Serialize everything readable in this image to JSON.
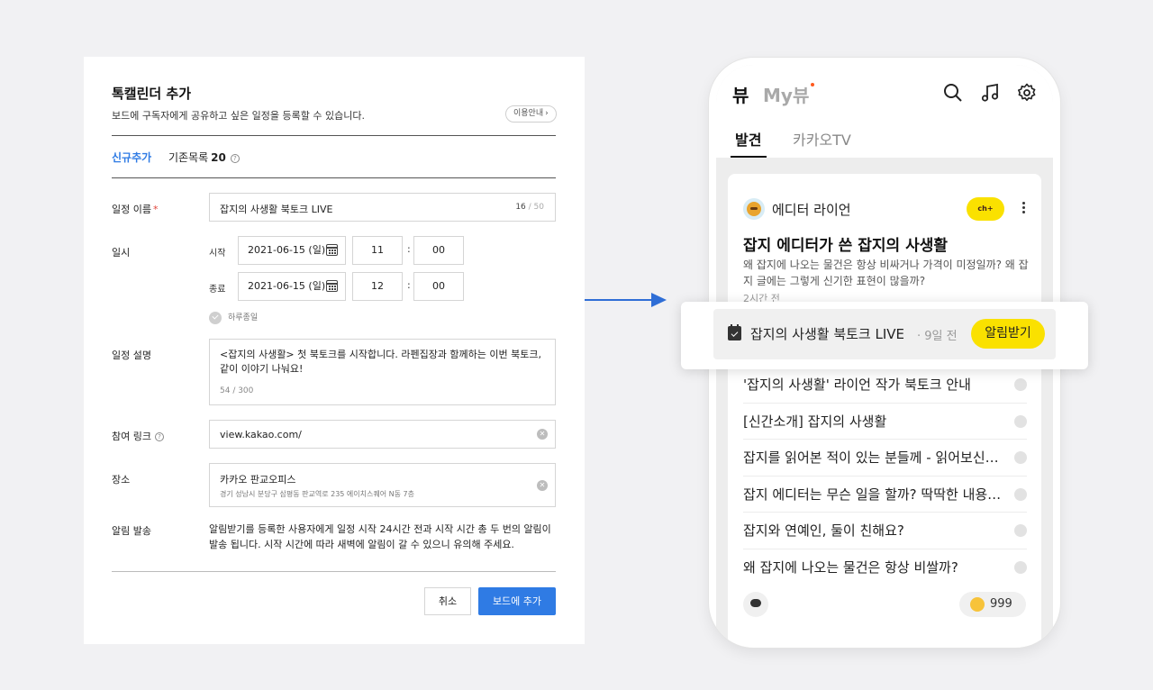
{
  "modal": {
    "title": "톡캘린더 추가",
    "subtitle": "보드에 구독자에게 공유하고 싶은 일정을 등록할 수 있습니다.",
    "guide_label": "이용안내",
    "tab_new": "신규추가",
    "tab_existing": "기존목록",
    "tab_existing_count": "20",
    "name_label": "일정 이름",
    "name_value": "잡지의 사생활 북토크 LIVE",
    "name_count": "16",
    "name_max": "/ 50",
    "datetime_label": "일시",
    "start_label": "시작",
    "start_date": "2021-06-15 (일)",
    "start_hour": "11",
    "start_min": "00",
    "end_label": "종료",
    "end_date": "2021-06-15 (일)",
    "end_hour": "12",
    "end_min": "00",
    "colon": ":",
    "allday_label": "하루종일",
    "desc_label": "일정 설명",
    "desc_value": "<잡지의 사생활> 첫 북토크를 시작합니다. 라펜집장과 함께하는 이번 북토크, 같이 이야기 나눠요!",
    "desc_count": "54 / 300",
    "link_label": "참여 링크",
    "link_value": "view.kakao.com/",
    "place_label": "장소",
    "place_value": "카카오 판교오피스",
    "place_address": "경기 성남시 분당구 삼평동 판교역로 235 에이치스퀘어 N동 7층",
    "notice_label": "알림 발송",
    "notice_text": "알림받기를 등록한 사용자에게 일정 시작 24시간 전과 시작 시간 총 두 번의 알림이 발송 됩니다. 시작 시간에 따라 새벽에 알림이 갈 수 있으니 유의해 주세요.",
    "cancel_label": "취소",
    "submit_label": "보드에 추가"
  },
  "phone": {
    "brand": "뷰",
    "my_tab": "My뷰",
    "tab_discover": "발견",
    "tab_kakaotv": "카카오TV",
    "channel_name": "에디터 라이언",
    "plus_channel": "ch+",
    "card_title": "잡지 에디터가 쓴 잡지의 사생활",
    "card_desc": "왜 잡지에 나오는 물건은 항상 비싸거나 가격이 미정일까? 왜 잡지 글에는 그렇게 신기한 표현이 많을까?",
    "card_time": "2시간 전",
    "list": [
      "'잡지의 사생활' 라이언 작가 북토크 안내",
      "[신간소개] 잡지의 사생활",
      "잡지를 읽어본 적이 있는 분들께 - 읽어보신…",
      "잡지 에디터는 무슨 일을 할까? 딱딱한 내용…",
      "잡지와 연예인, 둘이 친해요?",
      "왜 잡지에 나오는 물건은 항상 비쌀까?"
    ],
    "like_count": "999"
  },
  "popup": {
    "title": "잡지의 사생활 북토크 LIVE",
    "separator": "·",
    "time": "9일 전",
    "button_label": "알림받기"
  },
  "colors": {
    "accent_blue": "#2f7be4",
    "kakao_yellow": "#fae100",
    "required_red": "#e0443a"
  },
  "icons": [
    "calendar-icon",
    "check-icon",
    "clear-icon",
    "help-icon",
    "search-icon",
    "music-icon",
    "gear-icon",
    "more-icon",
    "comment-icon",
    "emoji-icon"
  ]
}
